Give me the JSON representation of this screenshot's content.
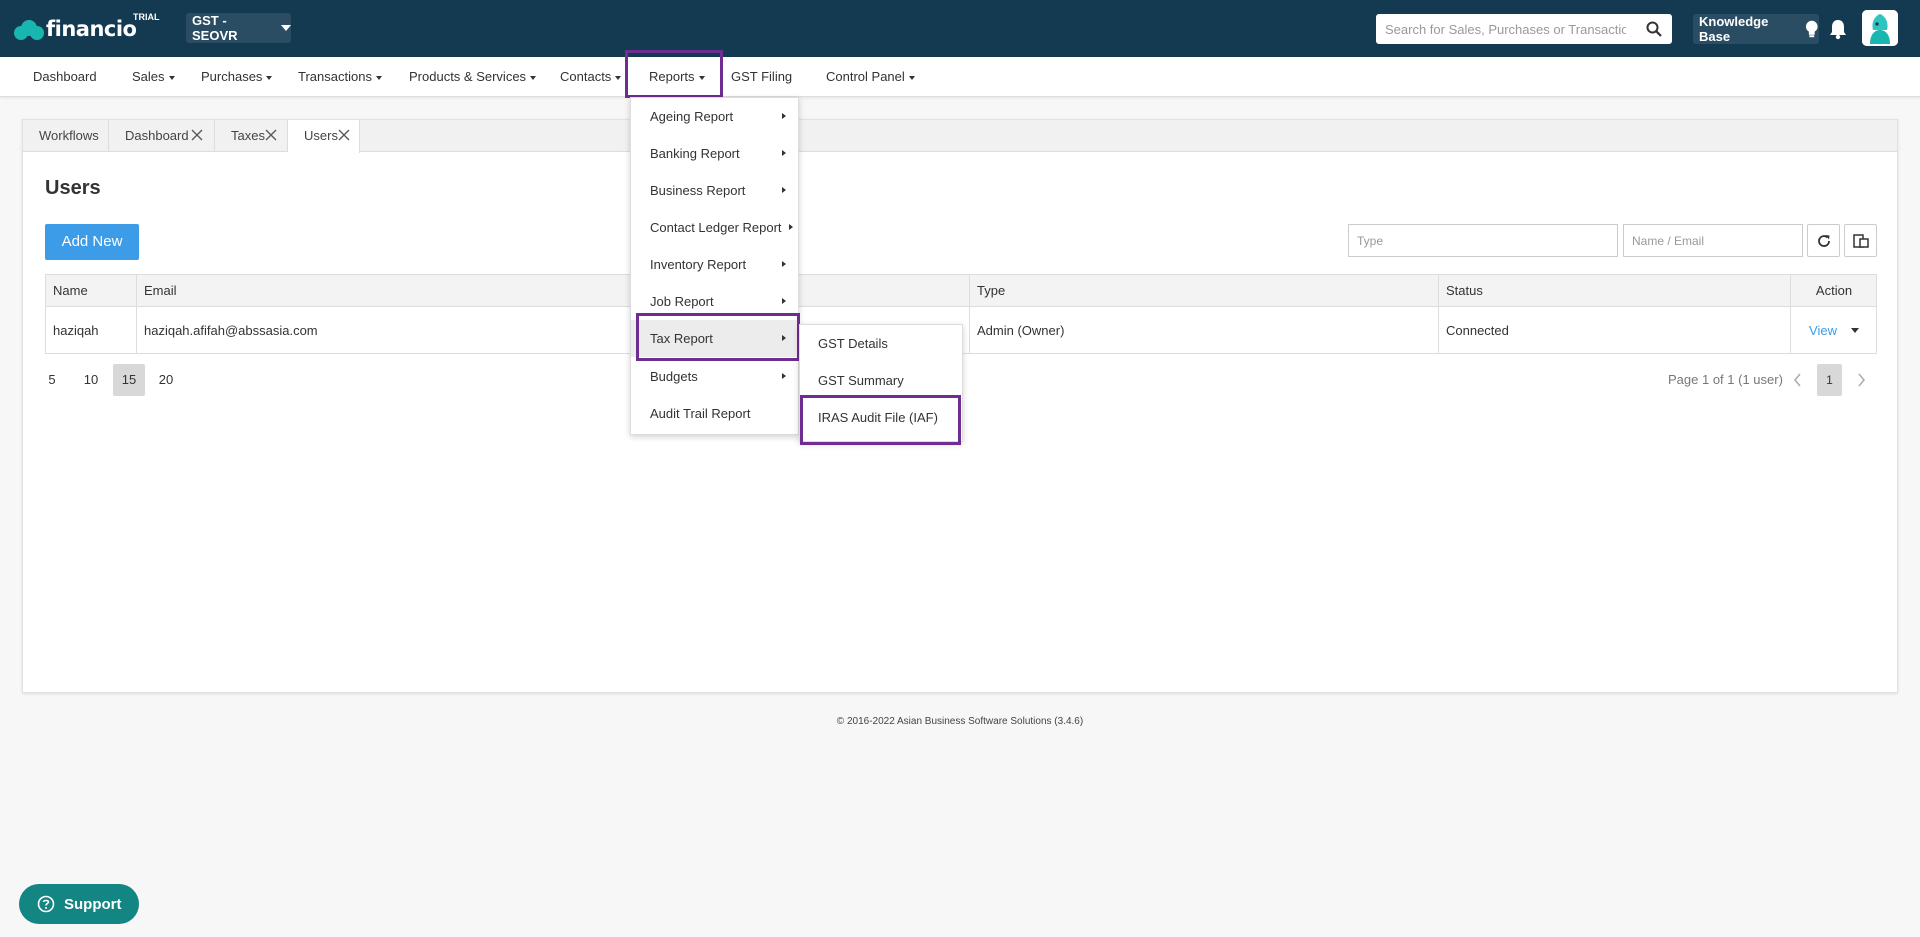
{
  "app": {
    "logo_text": "financio",
    "trial_badge": "TRIAL",
    "org_name": "GST -SEOVR",
    "search_placeholder": "Search for Sales, Purchases or Transactions",
    "knowledge_base_label": "Knowledge Base"
  },
  "nav": {
    "items": [
      "Dashboard",
      "Sales",
      "Purchases",
      "Transactions",
      "Products & Services",
      "Contacts",
      "Reports",
      "GST Filing",
      "Control Panel"
    ]
  },
  "tabs": [
    "Workflows",
    "Dashboard",
    "Taxes",
    "Users"
  ],
  "page": {
    "title": "Users",
    "add_button": "Add New",
    "filter_type_placeholder": "Type",
    "filter_name_placeholder": "Name / Email"
  },
  "table": {
    "columns": [
      "Name",
      "Email",
      "Type",
      "Status",
      "Action"
    ],
    "rows": [
      {
        "name": "haziqah",
        "email": "haziqah.afifah@abssasia.com",
        "type": "Admin (Owner)",
        "status": "Connected",
        "action": "View"
      }
    ]
  },
  "pagination": {
    "page_sizes": [
      "5",
      "10",
      "15",
      "20"
    ],
    "selected_size": "15",
    "info": "Page 1 of 1 (1 user)",
    "current_page": "1"
  },
  "reports_menu": {
    "items": [
      "Ageing Report",
      "Banking Report",
      "Business Report",
      "Contact Ledger Report",
      "Inventory Report",
      "Job Report",
      "Tax Report",
      "Budgets",
      "Audit Trail Report"
    ]
  },
  "tax_submenu": {
    "items": [
      "GST Details",
      "GST Summary",
      "IRAS Audit File (IAF)"
    ]
  },
  "footer": "© 2016-2022 Asian Business Software Solutions (3.4.6)",
  "support_label": "Support",
  "colors": {
    "topbar": "#143a52",
    "accent": "#3d9ce8",
    "highlight": "#6f2c91",
    "support": "#138583"
  }
}
